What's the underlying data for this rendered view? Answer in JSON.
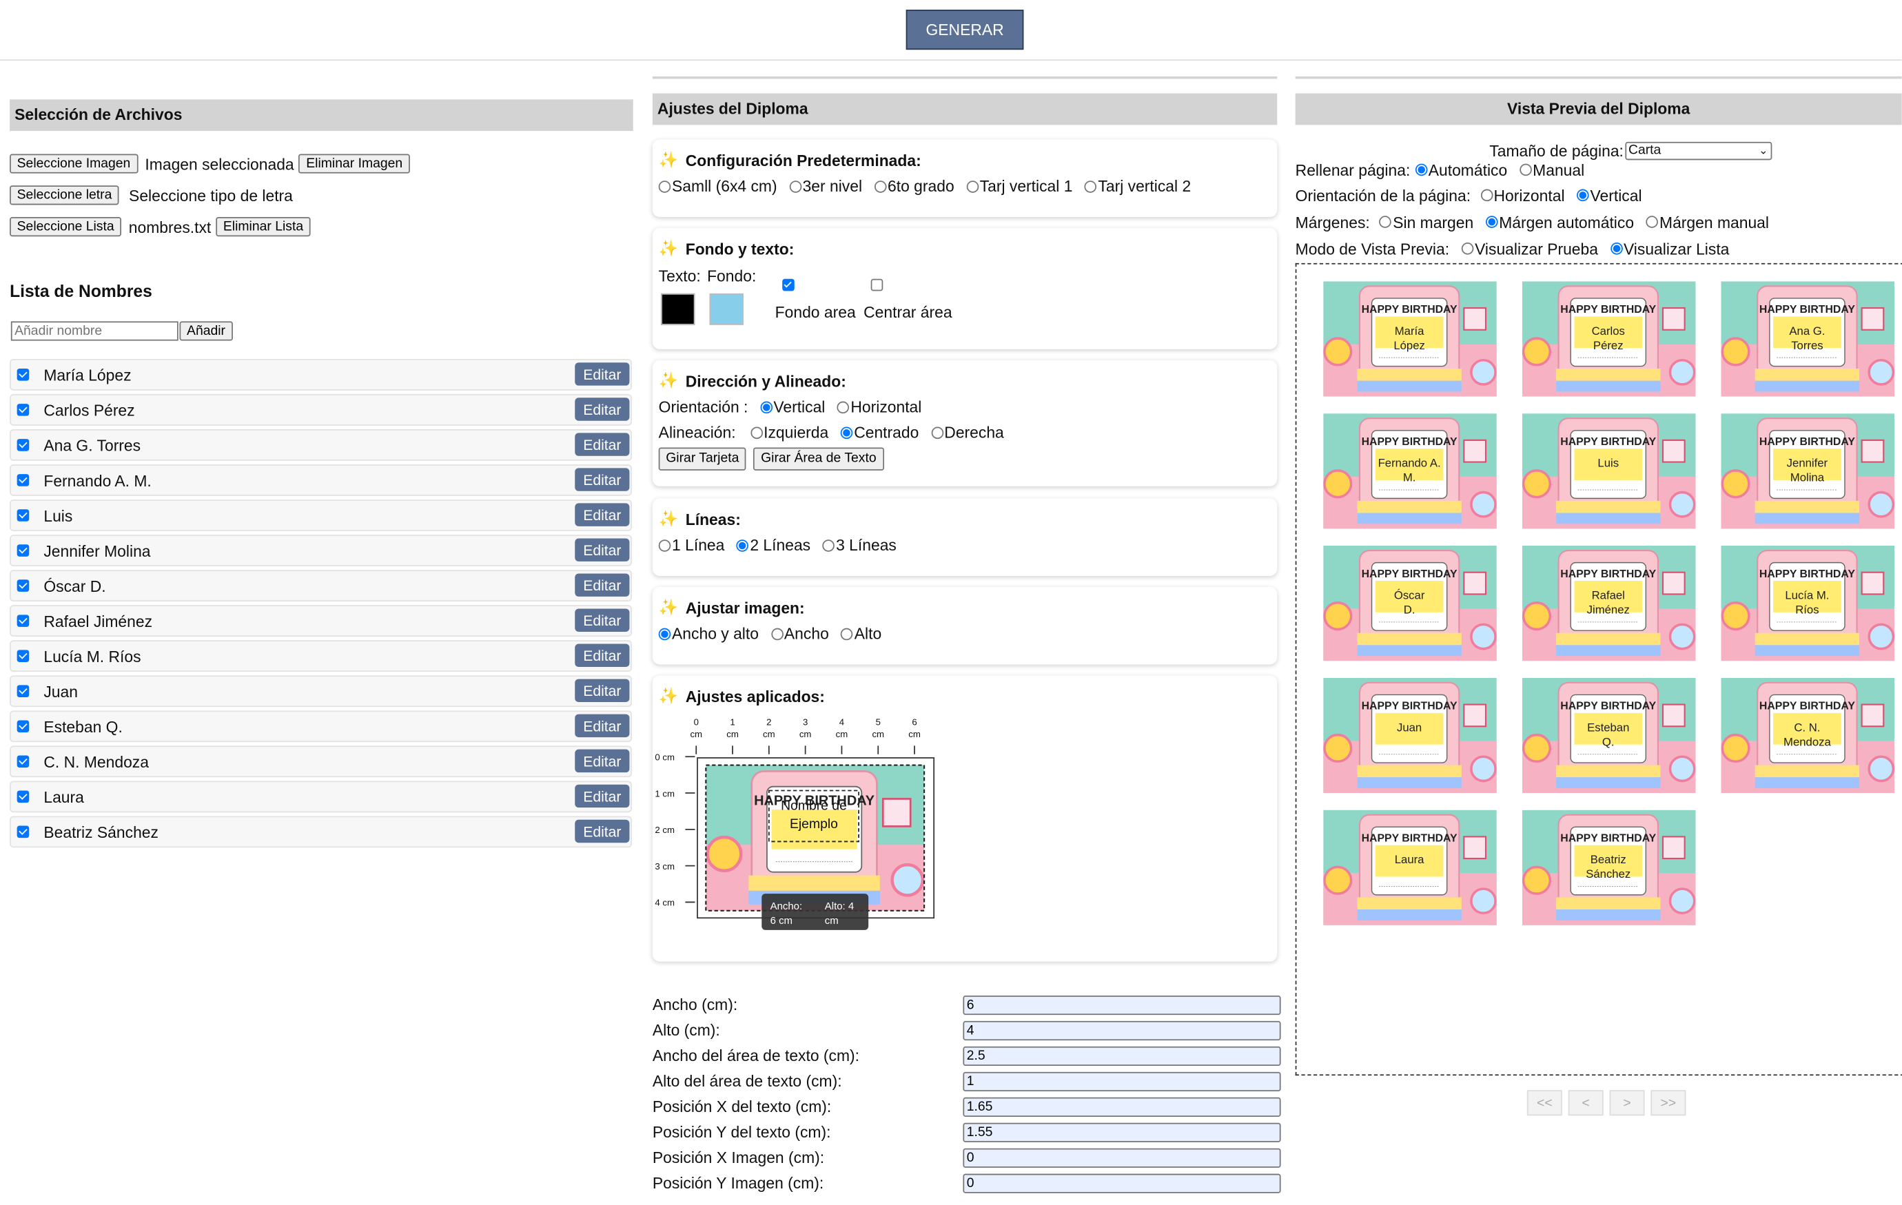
{
  "header": {
    "generate_label": "GENERAR"
  },
  "files": {
    "title": "Selección de Archivos",
    "select_image_label": "Seleccione Imagen",
    "image_status": "Imagen seleccionada",
    "remove_image_label": "Eliminar Imagen",
    "select_font_label": "Seleccione letra",
    "font_status": "Seleccione tipo de letra",
    "select_list_label": "Seleccione Lista",
    "list_status": "nombres.txt",
    "remove_list_label": "Eliminar Lista"
  },
  "names_list": {
    "title": "Lista de Nombres",
    "add_placeholder": "Añadir nombre",
    "add_label": "Añadir",
    "edit_label": "Editar",
    "items": [
      "María López",
      "Carlos Pérez",
      "Ana G. Torres",
      "Fernando A. M.",
      "Luis",
      "Jennifer Molina",
      "Óscar D.",
      "Rafael Jiménez",
      "Lucía M. Ríos",
      "Juan",
      "Esteban Q.",
      "C. N. Mendoza",
      "Laura",
      "Beatriz Sánchez"
    ]
  },
  "settings": {
    "title": "Ajustes del Diploma",
    "preset": {
      "title": "Configuración Predeterminada:",
      "options": [
        "Samll (6x4 cm)",
        "3er nivel",
        "6to grado",
        "Tarj vertical 1",
        "Tarj vertical 2"
      ]
    },
    "background": {
      "title": "Fondo y texto:",
      "text_label": "Texto:",
      "bg_label": "Fondo:",
      "text_color": "#000000",
      "bg_color": "#87ceeb",
      "fill_area_label": "Fondo area",
      "center_area_label": "Centrar área"
    },
    "direction": {
      "title": "Dirección y Alineado:",
      "orientation_label": "Orientación :",
      "vertical": "Vertical",
      "horizontal": "Horizontal",
      "align_label": "Alineación:",
      "left": "Izquierda",
      "center": "Centrado",
      "right": "Derecha",
      "rotate_card": "Girar Tarjeta",
      "rotate_text": "Girar Área de Texto"
    },
    "lines": {
      "title": "Líneas:",
      "options": [
        "1 Línea",
        "2 Líneas",
        "3 Líneas"
      ]
    },
    "fit": {
      "title": "Ajustar imagen:",
      "options": [
        "Ancho y alto",
        "Ancho",
        "Alto"
      ]
    },
    "applied": {
      "title": "Ajustes aplicados:",
      "x_ticks": [
        "0",
        "1",
        "2",
        "3",
        "4",
        "5",
        "6"
      ],
      "x_unit": "cm",
      "y_ticks": [
        "0 cm",
        "1 cm",
        "2 cm",
        "3 cm",
        "4 cm"
      ],
      "tooltip_w": "Ancho: 6 cm",
      "tooltip_h": "Alto: 4 cm",
      "sample_header": "HAPPY BIRTHDAY",
      "sample_name": "Nombre de Ejemplo"
    },
    "fields": [
      {
        "label": "Ancho (cm):",
        "value": "6"
      },
      {
        "label": "Alto (cm):",
        "value": "4"
      },
      {
        "label": "Ancho del área de texto (cm):",
        "value": "2.5"
      },
      {
        "label": "Alto del área de texto (cm):",
        "value": "1"
      },
      {
        "label": "Posición X del texto (cm):",
        "value": "1.65"
      },
      {
        "label": "Posición Y del texto (cm):",
        "value": "1.55"
      },
      {
        "label": "Posición X Imagen (cm):",
        "value": "0"
      },
      {
        "label": "Posición Y Imagen (cm):",
        "value": "0"
      }
    ]
  },
  "preview": {
    "title": "Vista Previa del Diploma",
    "page_size_label": "Tamaño de página:",
    "page_size_value": "Carta",
    "fill_label": "Rellenar página:",
    "fill_auto": "Automático",
    "fill_manual": "Manual",
    "orientation_label": "Orientación de la página:",
    "orient_h": "Horizontal",
    "orient_v": "Vertical",
    "margins_label": "Márgenes:",
    "margin_none": "Sin margen",
    "margin_auto": "Márgen automático",
    "margin_manual": "Márgen manual",
    "mode_label": "Modo de Vista Previa:",
    "mode_test": "Visualizar Prueba",
    "mode_list": "Visualizar Lista",
    "card_header": "HAPPY BIRTHDAY",
    "cards": [
      [
        "María",
        "López"
      ],
      [
        "Carlos",
        "Pérez"
      ],
      [
        "Ana G.",
        "Torres"
      ],
      [
        "Fernando A.",
        "M."
      ],
      [
        "Luis",
        ""
      ],
      [
        "Jennifer",
        "Molina"
      ],
      [
        "Óscar",
        "D."
      ],
      [
        "Rafael",
        "Jiménez"
      ],
      [
        "Lucía M.",
        "Ríos"
      ],
      [
        "Juan",
        ""
      ],
      [
        "Esteban",
        "Q."
      ],
      [
        "C. N.",
        "Mendoza"
      ],
      [
        "Laura",
        ""
      ],
      [
        "Beatriz",
        "Sánchez"
      ]
    ],
    "pager": [
      "<<",
      "<",
      ">",
      ">>"
    ]
  }
}
